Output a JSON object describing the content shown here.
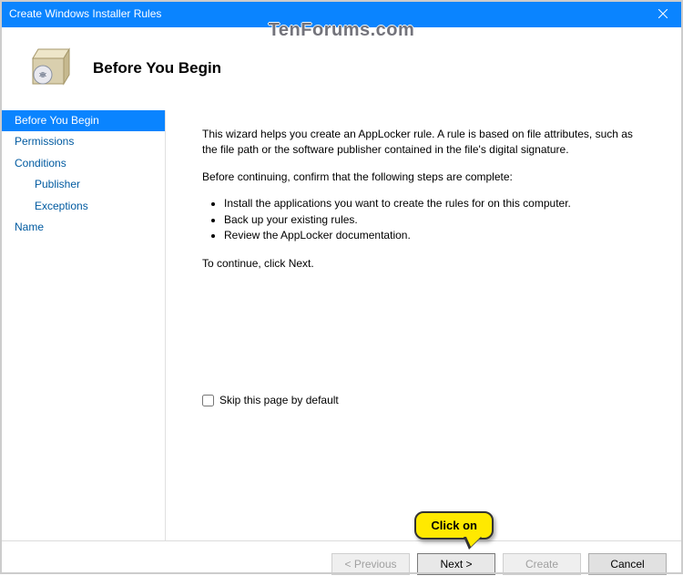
{
  "titlebar": {
    "title": "Create Windows Installer Rules"
  },
  "watermark": "TenForums.com",
  "header": {
    "title": "Before You Begin"
  },
  "sidebar": {
    "items": [
      {
        "label": "Before You Begin",
        "selected": true
      },
      {
        "label": "Permissions"
      },
      {
        "label": "Conditions"
      },
      {
        "label": "Publisher",
        "indent": true
      },
      {
        "label": "Exceptions",
        "indent": true
      },
      {
        "label": "Name"
      }
    ]
  },
  "main": {
    "intro": "This wizard helps you create an AppLocker rule. A rule is based on file attributes, such as the file path or the software publisher contained in the file's digital signature.",
    "before_line": "Before continuing, confirm that the following steps are complete:",
    "bullets": [
      "Install the applications you want to create the rules for on this computer.",
      "Back up your existing rules.",
      "Review the AppLocker documentation."
    ],
    "continue_line": "To continue, click Next.",
    "skip_label": "Skip this page by default",
    "skip_checked": false
  },
  "footer": {
    "previous": "< Previous",
    "next": "Next >",
    "create": "Create",
    "cancel": "Cancel"
  },
  "callout": {
    "text": "Click on"
  }
}
